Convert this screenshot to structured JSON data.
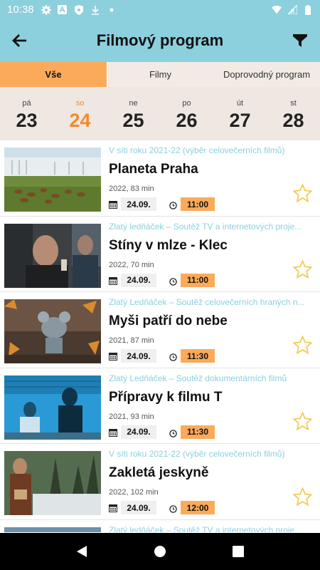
{
  "status_bar": {
    "time": "10:38",
    "icons": [
      "gear-icon",
      "a-icon",
      "shield-icon",
      "download-icon",
      "dot-icon",
      "wifi-icon",
      "signal-icon",
      "battery-icon"
    ]
  },
  "app_bar": {
    "title": "Filmový program",
    "back_icon": "arrow-left-icon",
    "filter_icon": "filter-icon"
  },
  "tabs": [
    {
      "label": "Vše",
      "active": true
    },
    {
      "label": "Filmy",
      "active": false
    },
    {
      "label": "Doprovodný program",
      "active": false
    }
  ],
  "days": [
    {
      "name": "pá",
      "num": "23",
      "active": false
    },
    {
      "name": "so",
      "num": "24",
      "active": true
    },
    {
      "name": "ne",
      "num": "25",
      "active": false
    },
    {
      "name": "po",
      "num": "26",
      "active": false
    },
    {
      "name": "út",
      "num": "27",
      "active": false
    },
    {
      "name": "st",
      "num": "28",
      "active": false
    }
  ],
  "colors": {
    "accent": "#8ccfdd",
    "orange": "#fbaa5a",
    "active_day": "#f28a2f",
    "star": "#f2c94c"
  },
  "films": [
    {
      "category": "V síti roku 2021-22 (výběr celovečerních filmů)",
      "title": "Planeta Praha",
      "meta": "2022, 83 min",
      "date": "24.09.",
      "time": "11:00"
    },
    {
      "category": "Zlatý ledňáček – Soutěž TV a internetových proje...",
      "title": "Stíny v mlze - Klec",
      "meta": "2022, 70 min",
      "date": "24.09.",
      "time": "11:00"
    },
    {
      "category": "Zlatý Ledňáček – Soutěž celovečerních hraných n...",
      "title": "Myši patří do nebe",
      "meta": "2021, 87 min",
      "date": "24.09.",
      "time": "11:30"
    },
    {
      "category": "Zlatý Ledňáček – Soutěž dokumentárních filmů",
      "title": "Přípravy k filmu T",
      "meta": "2021, 93 min",
      "date": "24.09.",
      "time": "11:30"
    },
    {
      "category": "V síti roku 2021-22 (výběr celovečerních filmů)",
      "title": "Zakletá jeskyně",
      "meta": "2022, 102 min",
      "date": "24.09.",
      "time": "12:00"
    },
    {
      "category": "Zlatý ledňáček – Soutěž TV a internetových proje...",
      "title": "",
      "meta": "",
      "date": "",
      "time": ""
    }
  ],
  "nav": [
    "back-triangle-icon",
    "home-circle-icon",
    "recents-square-icon"
  ]
}
